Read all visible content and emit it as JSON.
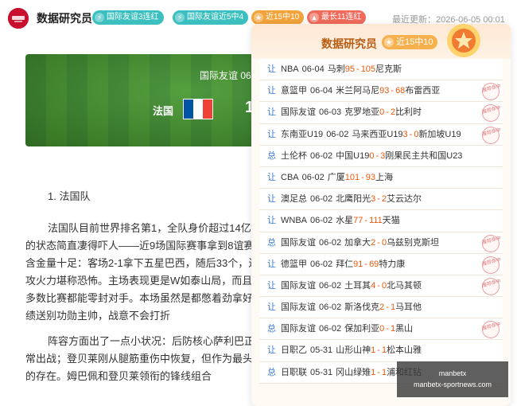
{
  "header": {
    "brand": "数据研究员",
    "tags": [
      {
        "label": "国际友谊3连红",
        "color": "#3bbfbf"
      },
      {
        "label": "国际友谊近5中4",
        "color": "#3bbfbf"
      },
      {
        "label": "近15中10",
        "color": "#f2a33a"
      },
      {
        "label": "最长11连红",
        "color": "#ef6b5b"
      }
    ],
    "updated": "最近更新：2026-06-05 00:01"
  },
  "banner": {
    "title": "国际友谊 06",
    "home_team": "法国",
    "score_partial": "1"
  },
  "article": {
    "heading": "1. 法国队",
    "paragraphs": [
      "法国队目前世界排名第1，全队身价超过14亿年的状态简直凄得吓人——近9场国际赛事拿到8谊赛含金量十足：客场2-1拿下五星巴西，随后33个，进攻火力堪称恐怖。主场表现更是W如泰山局，而且大多数比赛都能零封对手。本场虽然是都憋着劲拿好成绩送别功勋主帅，战意不会打折",
      "阵容方面出了一点小状况：后防核心萨利巴正常出战；登贝莱刚从腿筋重伤中恢复，但作为最头疼的存在。姆巴佩和登贝莱领衔的锋线组合"
    ]
  },
  "panel": {
    "title": "数据研究员",
    "badge": "近15中10",
    "rows": [
      {
        "kind": "让",
        "league": "NBA",
        "date": "06-04",
        "home": "马刺",
        "hs": "95",
        "as": "105",
        "away": "尼克斯",
        "stamp": false
      },
      {
        "kind": "让",
        "league": "意篮甲",
        "date": "06-04",
        "home": "米兰阿马尼",
        "hs": "93",
        "as": "68",
        "away": "布雷西亚",
        "stamp": true
      },
      {
        "kind": "让",
        "league": "国际友谊",
        "date": "06-03",
        "home": "克罗地亚",
        "hs": "0",
        "as": "2",
        "away": "比利时",
        "stamp": true
      },
      {
        "kind": "让",
        "league": "东南亚U19",
        "date": "06-02",
        "home": "马来西亚U19",
        "hs": "3",
        "as": "0",
        "away": "新加坡U19",
        "stamp": true
      },
      {
        "kind": "总",
        "league": "土伦杯",
        "date": "06-02",
        "home": "中国U19",
        "hs": "0",
        "as": "3",
        "away": "刚果民主共和国U23",
        "stamp": false
      },
      {
        "kind": "让",
        "league": "CBA",
        "date": "06-02",
        "home": "广厦",
        "hs": "101",
        "as": "93",
        "away": "上海",
        "stamp": false
      },
      {
        "kind": "让",
        "league": "澳足总",
        "date": "06-02",
        "home": "北鹰阳光",
        "hs": "3",
        "as": "2",
        "away": "艾云达尔",
        "stamp": false
      },
      {
        "kind": "让",
        "league": "WNBA",
        "date": "06-02",
        "home": "水星",
        "hs": "77",
        "as": "111",
        "away": "天猫",
        "stamp": false
      },
      {
        "kind": "总",
        "league": "国际友谊",
        "date": "06-02",
        "home": "加拿大",
        "hs": "2",
        "as": "0",
        "away": "乌兹别克斯坦",
        "stamp": true
      },
      {
        "kind": "让",
        "league": "德篮甲",
        "date": "06-02",
        "home": "拜仁",
        "hs": "91",
        "as": "69",
        "away": "特力康",
        "stamp": true
      },
      {
        "kind": "让",
        "league": "国际友谊",
        "date": "06-02",
        "home": "土耳其",
        "hs": "4",
        "as": "0",
        "away": "北马其顿",
        "stamp": true
      },
      {
        "kind": "让",
        "league": "国际友谊",
        "date": "06-02",
        "home": "斯洛伐克",
        "hs": "2",
        "as": "1",
        "away": "马耳他",
        "stamp": false
      },
      {
        "kind": "总",
        "league": "国际友谊",
        "date": "06-02",
        "home": "保加利亚",
        "hs": "0",
        "as": "1",
        "away": "黑山",
        "stamp": true
      },
      {
        "kind": "让",
        "league": "日职乙",
        "date": "05-31",
        "home": "山形山神",
        "hs": "1",
        "as": "1",
        "away": "松本山雅",
        "stamp": false
      },
      {
        "kind": "总",
        "league": "日职联",
        "date": "05-31",
        "home": "冈山绿雉",
        "hs": "1",
        "as": "1",
        "away": "浦和红钻",
        "stamp": false
      }
    ],
    "stamp_text": "推荐命中"
  },
  "watermark": {
    "line1": "manbetx",
    "line2": "manbetx-sportnews.com"
  }
}
